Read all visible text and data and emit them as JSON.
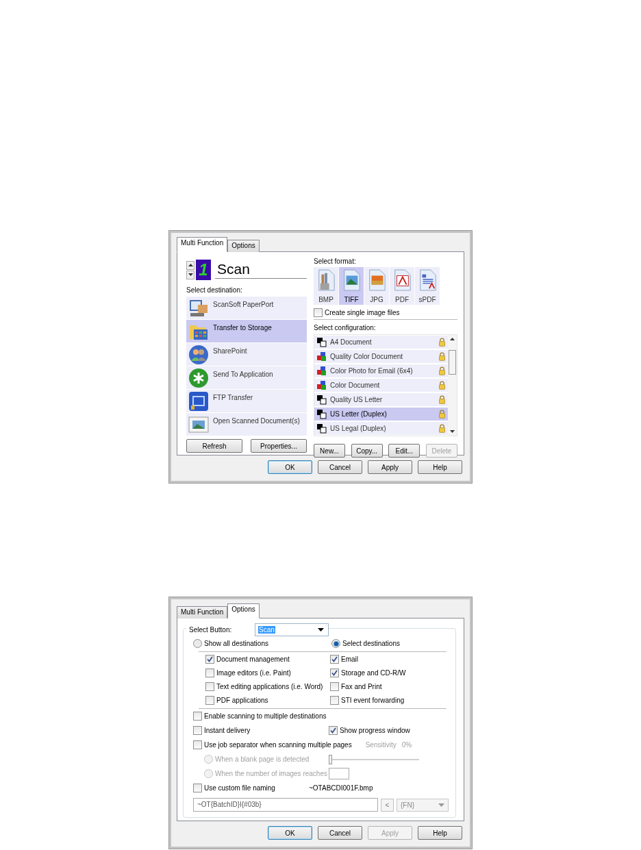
{
  "dialogs": [
    {
      "kind": "multi_function",
      "tabs": [
        {
          "label": "Multi Function",
          "selected": true
        },
        {
          "label": "Options",
          "selected": false
        }
      ],
      "button_display": {
        "number": "1",
        "name": "Scan"
      },
      "destination_label": "Select destination:",
      "destinations": [
        {
          "label": "ScanSoft PaperPort",
          "selected": false
        },
        {
          "label": "Transfer to Storage",
          "selected": true
        },
        {
          "label": "SharePoint",
          "selected": false
        },
        {
          "label": "Send To Application",
          "selected": false
        },
        {
          "label": "FTP Transfer",
          "selected": false
        },
        {
          "label": "Open Scanned Document(s)",
          "selected": false
        }
      ],
      "destination_buttons": [
        {
          "label": "Refresh",
          "disabled": false
        },
        {
          "label": "Properties...",
          "disabled": false
        }
      ],
      "format_label": "Select format:",
      "formats": [
        {
          "label": "BMP",
          "selected": false
        },
        {
          "label": "TIFF",
          "selected": true
        },
        {
          "label": "JPG",
          "selected": false
        },
        {
          "label": "PDF",
          "selected": false
        },
        {
          "label": "sPDF",
          "selected": false
        }
      ],
      "single_image": {
        "label": "Create single image files",
        "checked": false
      },
      "configuration_label": "Select configuration:",
      "configurations": [
        {
          "label": "A4 Document",
          "kind": "bw",
          "selected": false
        },
        {
          "label": "Quality Color Document",
          "kind": "color",
          "selected": false
        },
        {
          "label": "Color Photo for Email (6x4)",
          "kind": "color",
          "selected": false
        },
        {
          "label": "Color Document",
          "kind": "color",
          "selected": false
        },
        {
          "label": "Quality US Letter",
          "kind": "bw",
          "selected": false
        },
        {
          "label": "US Letter (Duplex)",
          "kind": "bw",
          "selected": true
        },
        {
          "label": "US Legal (Duplex)",
          "kind": "bw",
          "selected": false
        }
      ],
      "configuration_buttons": [
        {
          "label": "New...",
          "disabled": false
        },
        {
          "label": "Copy...",
          "disabled": false
        },
        {
          "label": "Edit...",
          "disabled": false
        },
        {
          "label": "Delete",
          "disabled": true
        }
      ],
      "footer_buttons": [
        {
          "label": "OK",
          "default": true,
          "disabled": false
        },
        {
          "label": "Cancel",
          "default": false,
          "disabled": false
        },
        {
          "label": "Apply",
          "default": false,
          "disabled": false
        },
        {
          "label": "Help",
          "default": false,
          "disabled": false
        }
      ]
    },
    {
      "kind": "options",
      "tabs": [
        {
          "label": "Multi Function",
          "selected": false
        },
        {
          "label": "Options",
          "selected": true
        }
      ],
      "select_button": {
        "label": "Select Button:",
        "value": "Scan"
      },
      "destination_modes": [
        {
          "label": "Show all destinations",
          "selected": false
        },
        {
          "label": "Select destinations",
          "selected": true
        }
      ],
      "destination_types": [
        {
          "label": "Document management",
          "checked": true
        },
        {
          "label": "Email",
          "checked": true
        },
        {
          "label": "Image editors (i.e. Paint)",
          "checked": false
        },
        {
          "label": "Storage and CD-R/W",
          "checked": true
        },
        {
          "label": "Text editing applications (i.e. Word)",
          "checked": false
        },
        {
          "label": "Fax and Print",
          "checked": false
        },
        {
          "label": "PDF applications",
          "checked": false
        },
        {
          "label": "STI event forwarding",
          "checked": false
        }
      ],
      "multiple_destinations": {
        "label": "Enable scanning to multiple destinations",
        "checked": false
      },
      "instant_delivery": {
        "label": "Instant delivery",
        "checked": false
      },
      "progress_window": {
        "label": "Show progress window",
        "checked": true
      },
      "job_separator": {
        "label": "Use job separator when scanning multiple pages",
        "checked": false,
        "disabled": true,
        "sensitivity_label": "Sensitivity",
        "sensitivity_value": "0%",
        "level": 0,
        "modes": [
          {
            "label": "When a blank page is detected",
            "selected": false
          },
          {
            "label": "When the number of images reaches",
            "selected": false
          }
        ]
      },
      "custom_naming": {
        "label": "Use custom file naming",
        "checked": false,
        "preview": "~OTABCDI001F.bmp",
        "pattern": "~OT{BatchID}I{#03b}",
        "insert_button": "<",
        "token": "{FN}",
        "token_disabled": true
      },
      "footer_buttons": [
        {
          "label": "OK",
          "default": true,
          "disabled": false
        },
        {
          "label": "Cancel",
          "default": false,
          "disabled": false
        },
        {
          "label": "Apply",
          "default": false,
          "disabled": true
        },
        {
          "label": "Help",
          "default": false,
          "disabled": false
        }
      ]
    }
  ]
}
